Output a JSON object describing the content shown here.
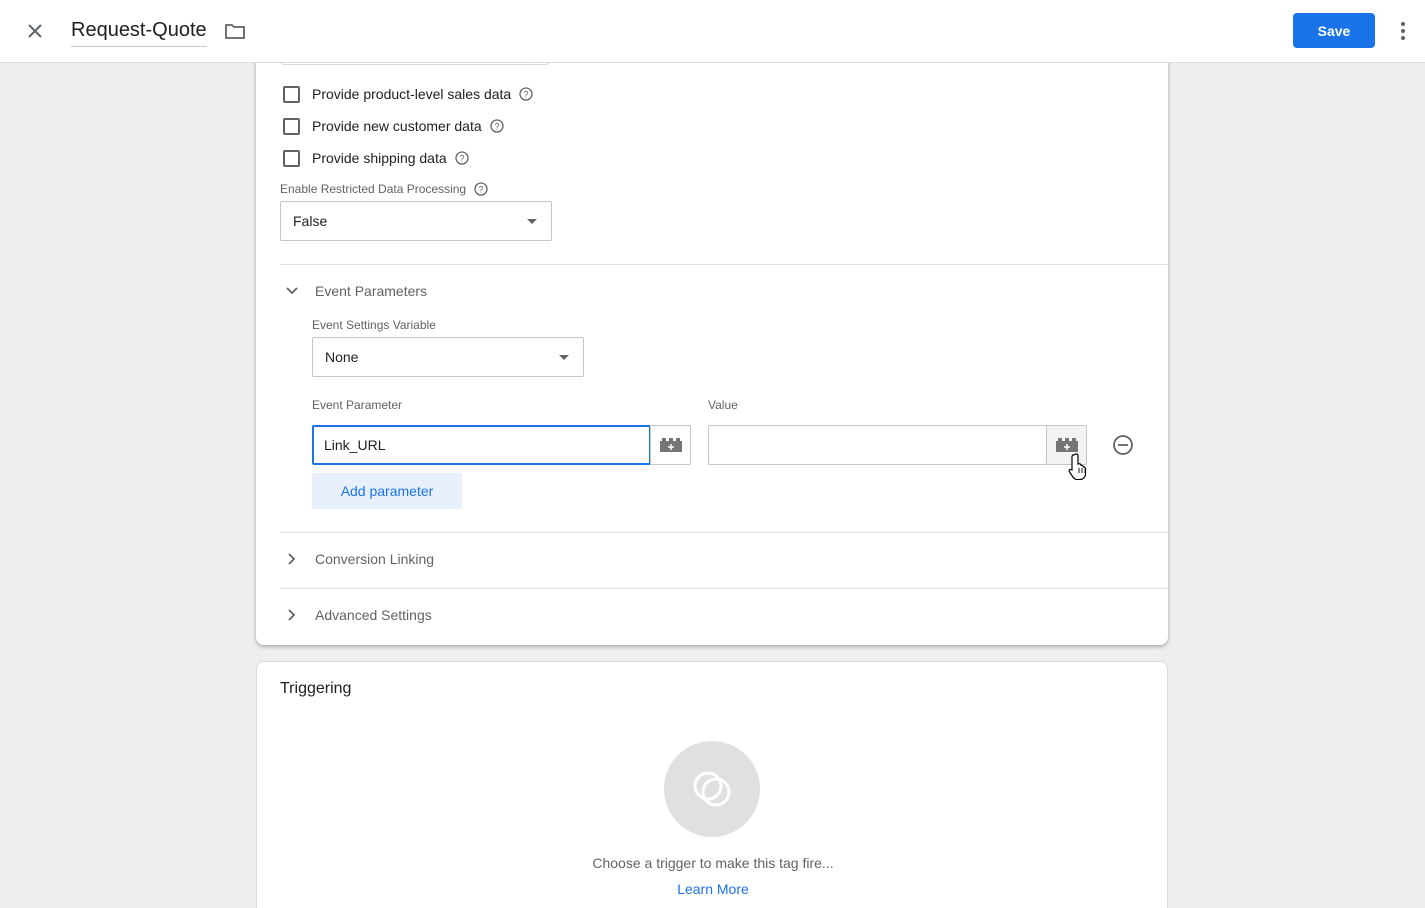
{
  "header": {
    "close_icon": "close-icon",
    "title": "Request-Quote",
    "folder_icon": "folder-icon",
    "save_label": "Save",
    "more_icon": "more-vert-icon",
    "accent_color": "#1a73e8"
  },
  "config": {
    "checkboxes": [
      {
        "label": "Provide product-level sales data",
        "checked": false
      },
      {
        "label": "Provide new customer data",
        "checked": false
      },
      {
        "label": "Provide shipping data",
        "checked": false
      }
    ],
    "restricted": {
      "label": "Enable Restricted Data Processing",
      "value": "False"
    },
    "event_parameters": {
      "title": "Event Parameters",
      "expanded": true,
      "settings_variable_label": "Event Settings Variable",
      "settings_variable_value": "None",
      "param_column_label": "Event Parameter",
      "value_column_label": "Value",
      "rows": [
        {
          "parameter": "Link_URL",
          "value": ""
        }
      ],
      "add_button": "Add parameter"
    },
    "sections": [
      {
        "title": "Conversion Linking",
        "expanded": false
      },
      {
        "title": "Advanced Settings",
        "expanded": false
      }
    ]
  },
  "triggering": {
    "title": "Triggering",
    "hint": "Choose a trigger to make this tag fire...",
    "learn_more": "Learn More"
  }
}
